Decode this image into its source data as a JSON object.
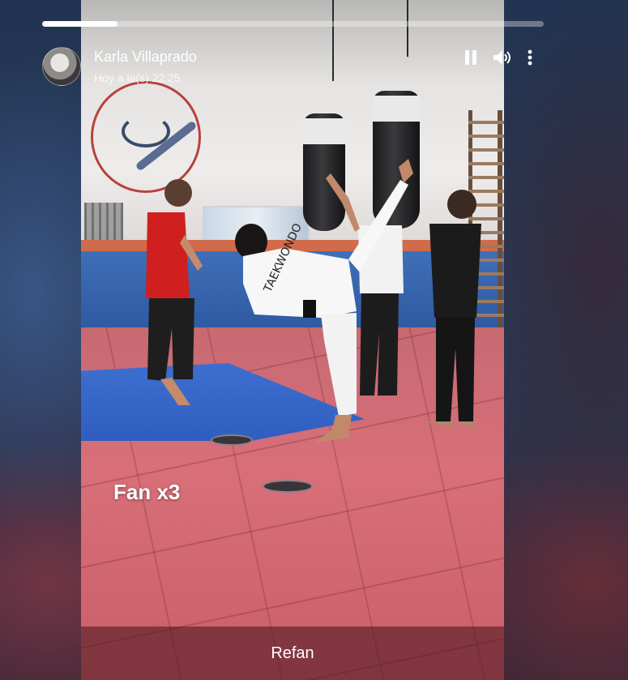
{
  "story": {
    "progress_fraction": 0.15,
    "user_name": "Karla Villaprado",
    "timestamp": "Hoy a la(s) 22:25",
    "caption": "Fan x3",
    "footer_text": "Refan"
  },
  "icons": {
    "pause": "pause-icon",
    "volume": "volume-icon",
    "more": "more-options-icon"
  },
  "colors": {
    "progress_fill": "#ffffff",
    "progress_track": "rgba(255,255,255,0.35)",
    "text": "#ffffff"
  }
}
